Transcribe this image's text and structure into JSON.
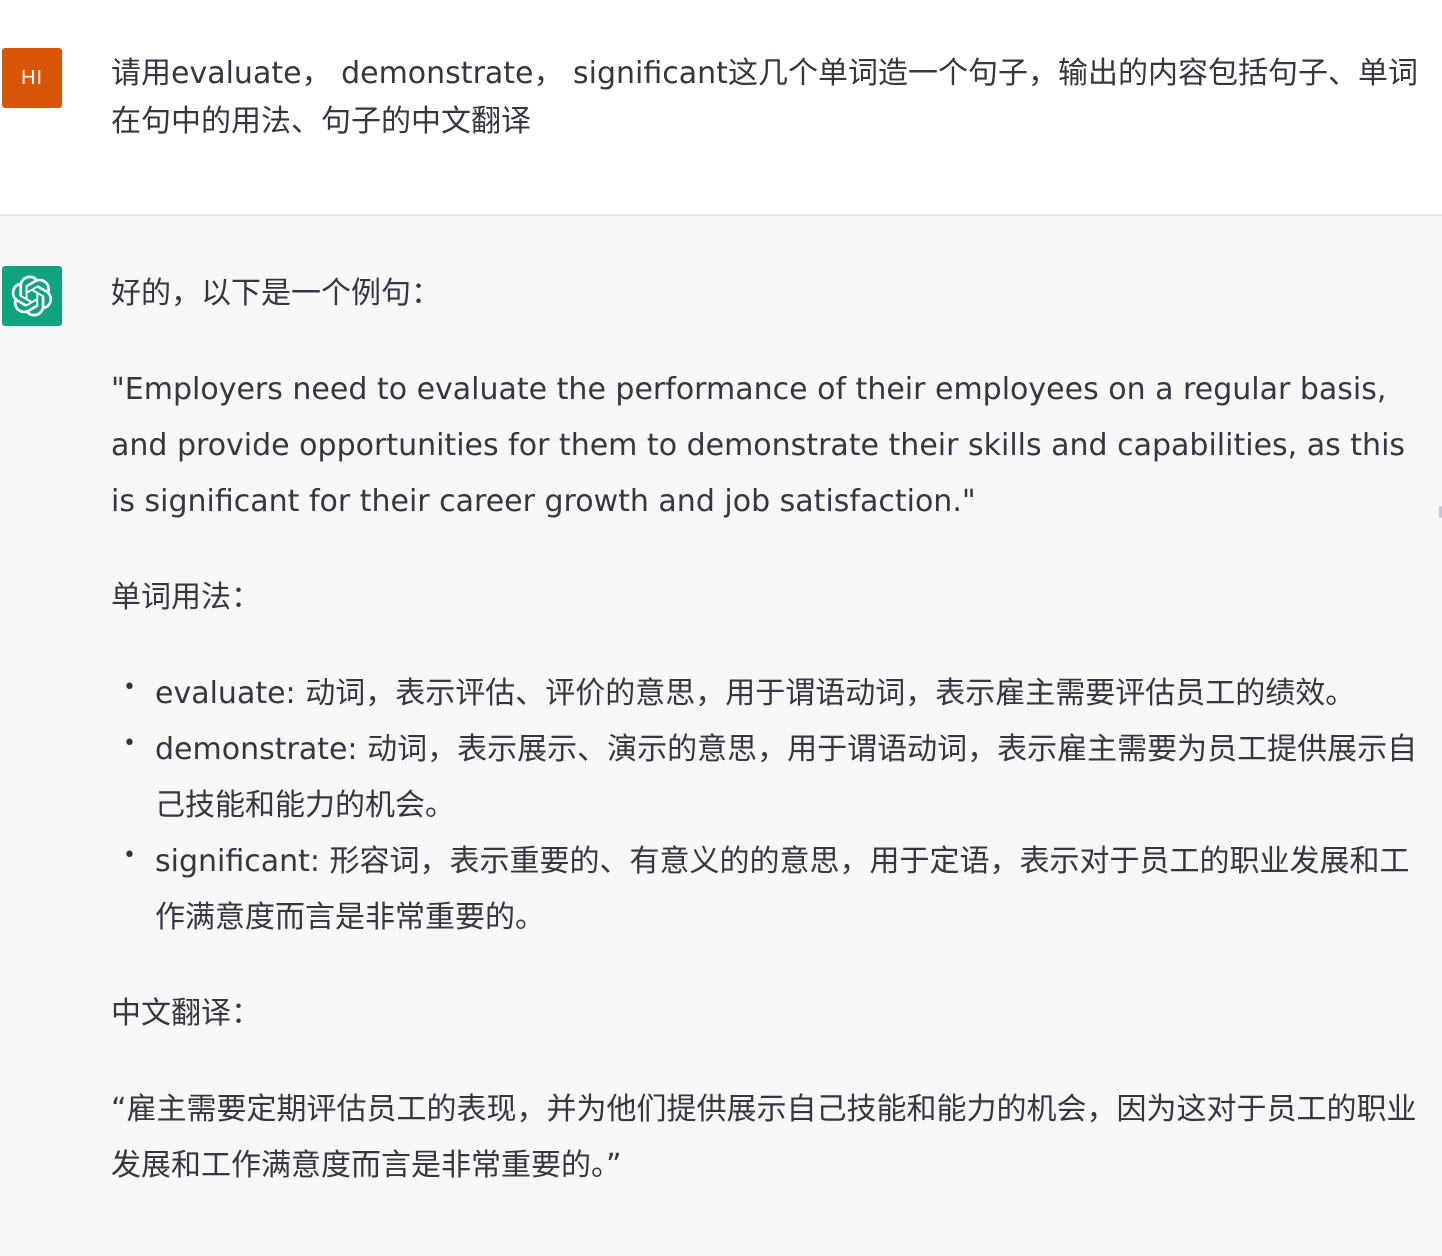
{
  "user": {
    "avatar_initials": "HI",
    "message": "请用evaluate， demonstrate， significant这几个单词造一个句子，输出的内容包括句子、单词在句中的用法、句子的中文翻译"
  },
  "assistant": {
    "avatar_icon": "openai-logo-icon",
    "intro": "好的，以下是一个例句：",
    "sentence": "\"Employers need to evaluate the performance of their employees on a regular basis, and provide opportunities for them to demonstrate their skills and capabilities, as this is significant for their career growth and job satisfaction.\"",
    "usage_heading": "单词用法：",
    "usage_items": [
      {
        "bullet": "•",
        "text": "evaluate: 动词，表示评估、评价的意思，用于谓语动词，表示雇主需要评估员工的绩效。"
      },
      {
        "bullet": "•",
        "text": "demonstrate: 动词，表示展示、演示的意思，用于谓语动词，表示雇主需要为员工提供展示自己技能和能力的机会。"
      },
      {
        "bullet": "•",
        "text": "significant: 形容词，表示重要的、有意义的的意思，用于定语，表示对于员工的职业发展和工作满意度而言是非常重要的。"
      }
    ],
    "translation_heading": "中文翻译：",
    "translation": "“雇主需要定期评估员工的表现，并为他们提供展示自己技能和能力的机会，因为这对于员工的职业发展和工作满意度而言是非常重要的。”"
  },
  "colors": {
    "user_avatar_bg": "#d9550a",
    "bot_avatar_bg": "#10a37f",
    "assistant_bg": "#f7f7f8",
    "text": "#353740"
  }
}
